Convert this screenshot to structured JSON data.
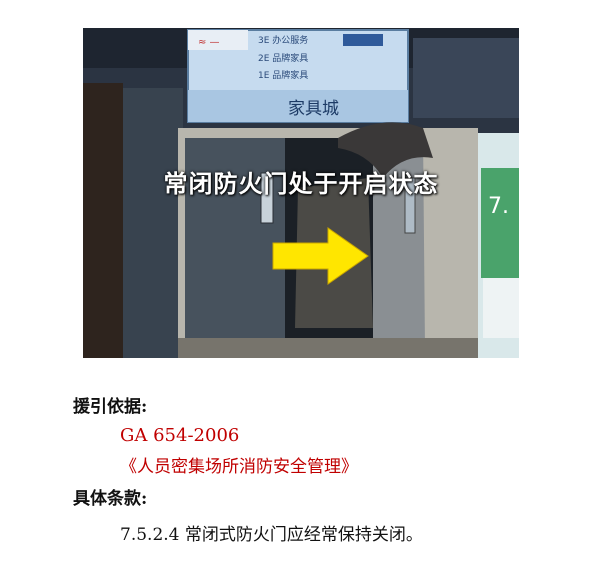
{
  "photo": {
    "caption": "常闭防火门处于开启状态",
    "sign_store": "家具城",
    "sign_floor_3": "3E 办公服务",
    "sign_floor_2": "2E 品牌家具",
    "sign_floor_1": "1E 品牌家具",
    "side_sign": "7.",
    "arrow_color": "#ffe600"
  },
  "basis": {
    "heading": "援引依据:",
    "standard": "GA 654-2006",
    "document": "《人员密集场所消防安全管理》"
  },
  "clause": {
    "heading": "具体条款:",
    "text": "7.5.2.4 常闭式防火门应经常保持关闭。"
  }
}
